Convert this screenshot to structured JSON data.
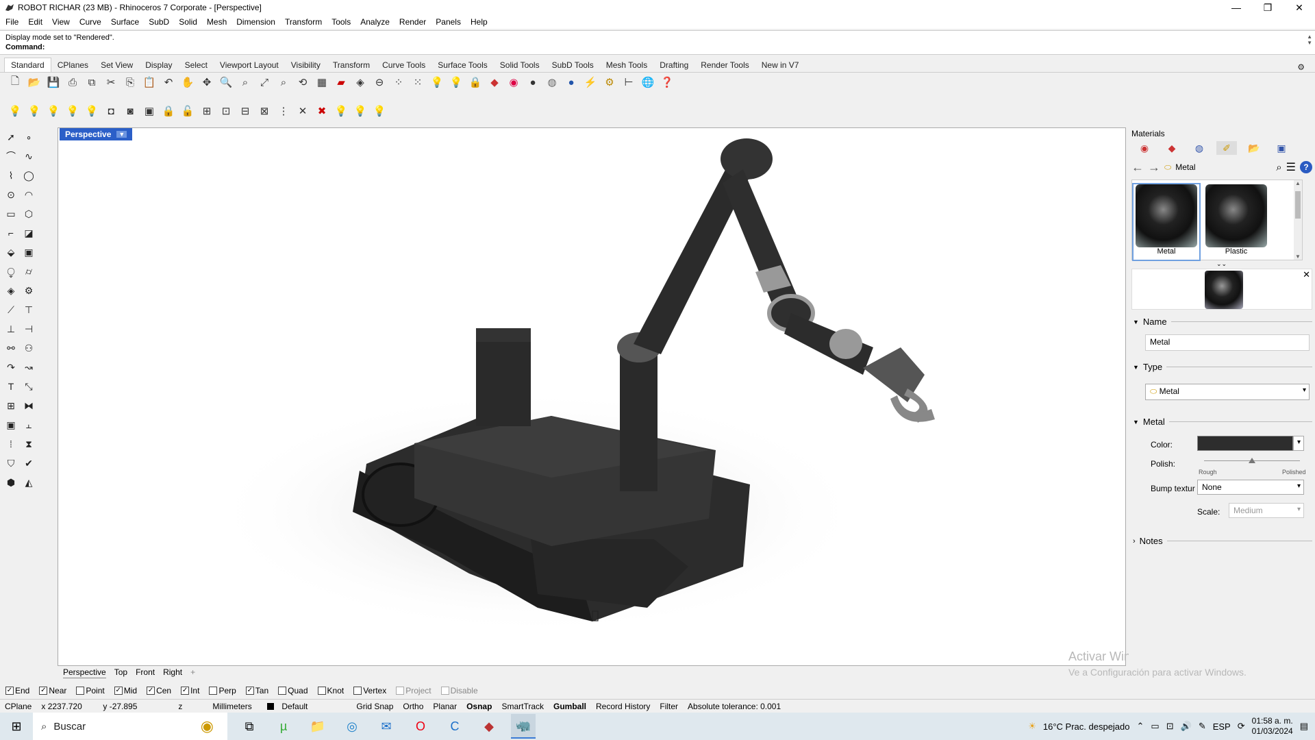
{
  "window": {
    "title": "ROBOT RICHAR (23 MB) - Rhinoceros 7 Corporate - [Perspective]",
    "controls": [
      "—",
      "❐",
      "✕"
    ]
  },
  "menu": [
    "File",
    "Edit",
    "View",
    "Curve",
    "Surface",
    "SubD",
    "Solid",
    "Mesh",
    "Dimension",
    "Transform",
    "Tools",
    "Analyze",
    "Render",
    "Panels",
    "Help"
  ],
  "command": {
    "history": "Display mode set to \"Rendered\".",
    "label": "Command:",
    "value": ""
  },
  "toolbar_tabs": [
    "Standard",
    "CPlanes",
    "Set View",
    "Display",
    "Select",
    "Viewport Layout",
    "Visibility",
    "Transform",
    "Curve Tools",
    "Surface Tools",
    "Solid Tools",
    "SubD Tools",
    "Mesh Tools",
    "Drafting",
    "Render Tools",
    "New in V7"
  ],
  "viewport": {
    "name": "Perspective",
    "tabs": [
      "Perspective",
      "Top",
      "Front",
      "Right"
    ],
    "add": "+"
  },
  "osnaps": [
    {
      "label": "End",
      "checked": true
    },
    {
      "label": "Near",
      "checked": true
    },
    {
      "label": "Point",
      "checked": false
    },
    {
      "label": "Mid",
      "checked": true
    },
    {
      "label": "Cen",
      "checked": true
    },
    {
      "label": "Int",
      "checked": true
    },
    {
      "label": "Perp",
      "checked": false
    },
    {
      "label": "Tan",
      "checked": true
    },
    {
      "label": "Quad",
      "checked": false
    },
    {
      "label": "Knot",
      "checked": false
    },
    {
      "label": "Vertex",
      "checked": false
    },
    {
      "label": "Project",
      "checked": false,
      "disabled": true
    },
    {
      "label": "Disable",
      "checked": false,
      "disabled": true
    }
  ],
  "status": {
    "cplane": "CPlane",
    "x": "x 2237.720",
    "y": "y -27.895",
    "z": "z",
    "units": "Millimeters",
    "layer": "Default",
    "grid_snap": "Grid Snap",
    "ortho": "Ortho",
    "planar": "Planar",
    "osnap": "Osnap",
    "smarttrack": "SmartTrack",
    "gumball": "Gumball",
    "record_history": "Record History",
    "filter": "Filter",
    "tolerance": "Absolute tolerance: 0.001"
  },
  "activation": {
    "line1": "Activar Windows",
    "line2": "Ve a Configuración para activar Windows."
  },
  "materials": {
    "panel_title": "Materials",
    "current": "Metal",
    "items": [
      {
        "name": "Metal",
        "selected": true
      },
      {
        "name": "Plastic",
        "selected": false
      }
    ],
    "name_section": "Name",
    "name_value": "Metal",
    "type_section": "Type",
    "type_value": "Metal",
    "metal_section": "Metal",
    "color_label": "Color:",
    "color_value": "#2d2d2d",
    "polish_label": "Polish:",
    "polish_rough": "Rough",
    "polish_polished": "Polished",
    "polish_level": 0.5,
    "bump_label": "Bump textur",
    "bump_value": "None",
    "scale_label": "Scale:",
    "scale_value": "Medium",
    "notes_section": "Notes"
  },
  "taskbar": {
    "search": "Buscar",
    "weather": "16°C  Prac. despejado",
    "lang": "ESP",
    "time": "01:58 a. m.",
    "date": "01/03/2024"
  }
}
